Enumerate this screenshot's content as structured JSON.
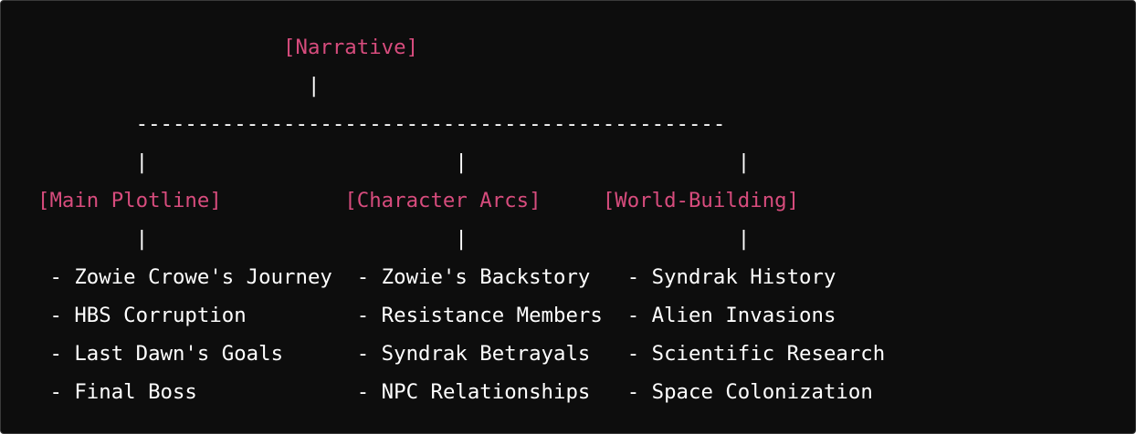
{
  "diagram": {
    "root": "[Narrative]",
    "branches": [
      {
        "label": "[Main Plotline]",
        "items": [
          "- Zowie Crowe's Journey",
          "- HBS Corruption",
          "- Last Dawn's Goals",
          "- Final Boss"
        ]
      },
      {
        "label": "[Character Arcs]",
        "items": [
          "- Zowie's Backstory",
          "- Resistance Members",
          "- Syndrak Betrayals",
          "- NPC Relationships"
        ]
      },
      {
        "label": "[World-Building]",
        "items": [
          "- Syndrak History",
          "- Alien Invasions",
          "- Scientific Research",
          "- Space Colonization"
        ]
      }
    ],
    "connectors": {
      "pipe": "|",
      "horizontal": "------------------------------------------------"
    },
    "colors": {
      "background": "#0d0d0d",
      "node": "#d74c7d",
      "text": "#ffffff"
    }
  }
}
